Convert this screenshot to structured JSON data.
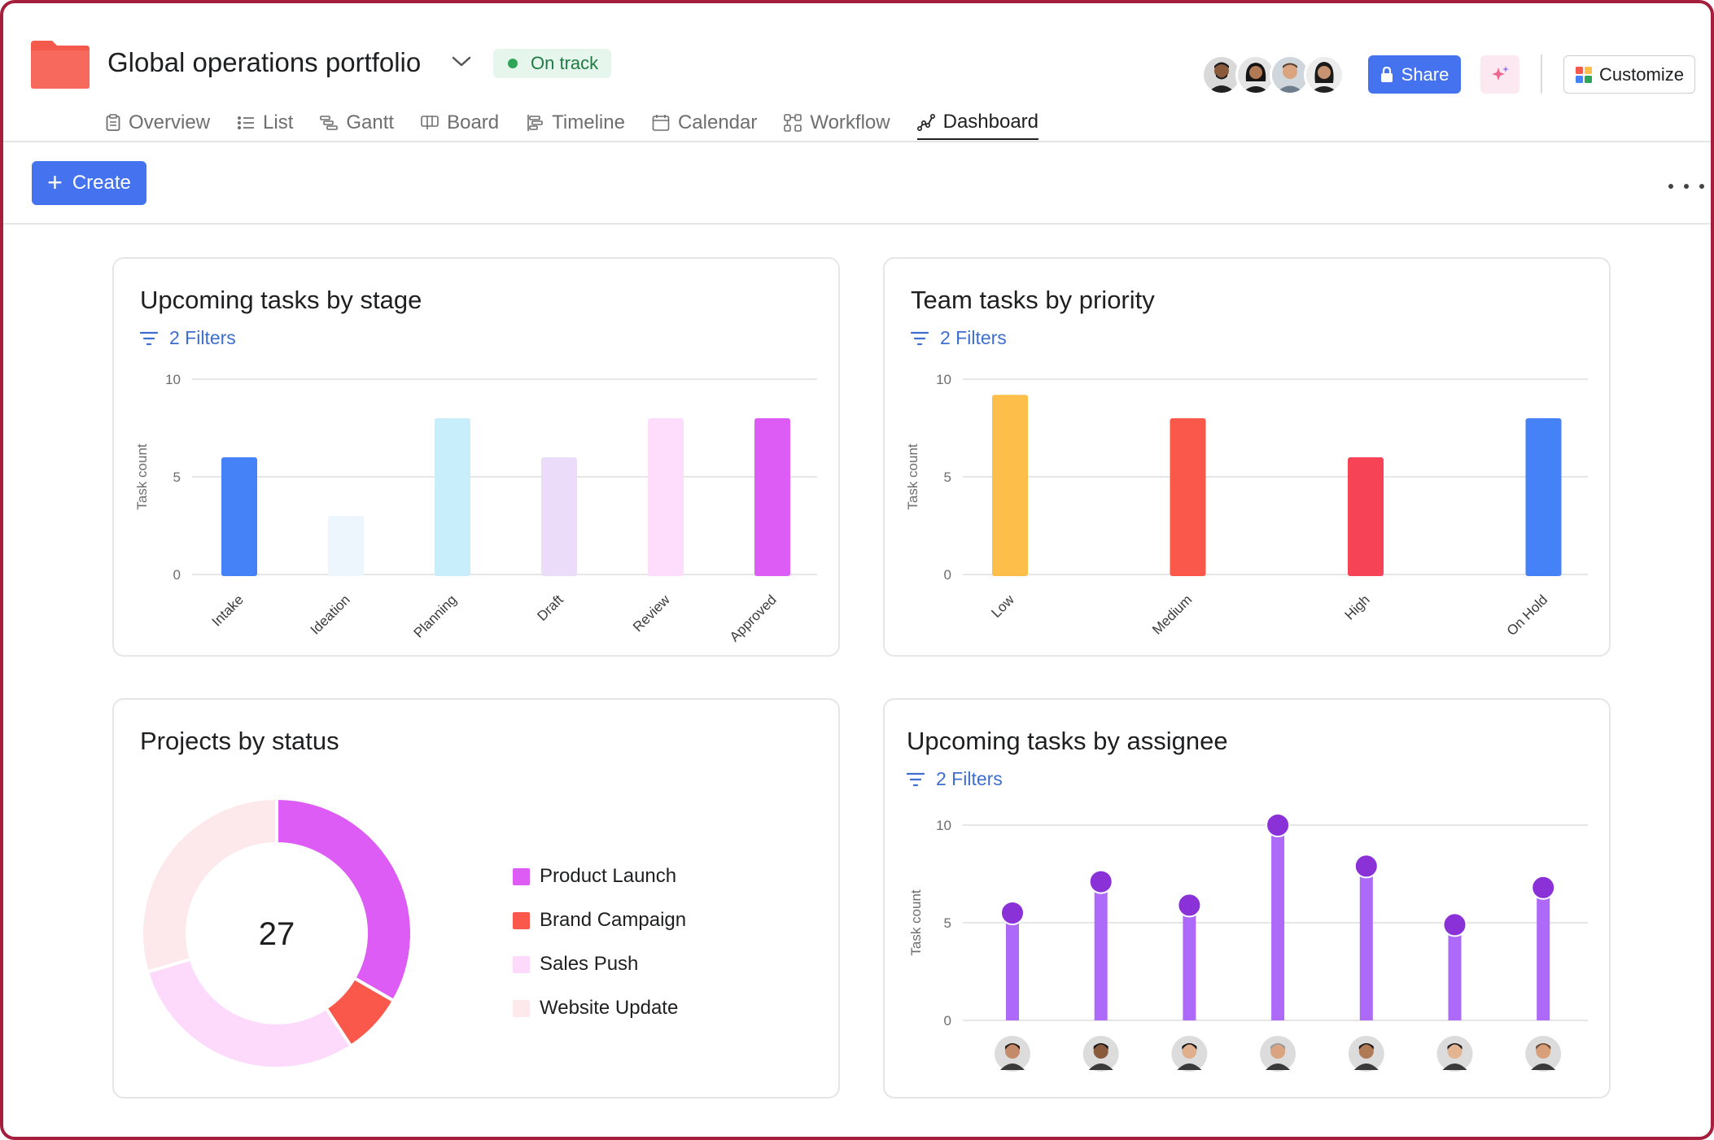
{
  "header": {
    "title": "Global operations portfolio",
    "status": {
      "label": "On track",
      "color": "#2fa55a"
    },
    "share_label": "Share",
    "customize_label": "Customize",
    "folder_color": "#f45a4c"
  },
  "tabs": [
    {
      "label": "Overview",
      "icon": "overview-icon",
      "active": false
    },
    {
      "label": "List",
      "icon": "list-icon",
      "active": false
    },
    {
      "label": "Gantt",
      "icon": "gantt-icon",
      "active": false
    },
    {
      "label": "Board",
      "icon": "board-icon",
      "active": false
    },
    {
      "label": "Timeline",
      "icon": "timeline-icon",
      "active": false
    },
    {
      "label": "Calendar",
      "icon": "calendar-icon",
      "active": false
    },
    {
      "label": "Workflow",
      "icon": "workflow-icon",
      "active": false
    },
    {
      "label": "Dashboard",
      "icon": "dashboard-icon",
      "active": true
    }
  ],
  "toolbar": {
    "create_label": "Create"
  },
  "cards": {
    "stage": {
      "title": "Upcoming tasks by stage",
      "filter_label": "2 Filters"
    },
    "priority": {
      "title": "Team tasks by priority",
      "filter_label": "2 Filters"
    },
    "projects": {
      "title": "Projects by status"
    },
    "assignee": {
      "title": "Upcoming tasks by assignee",
      "filter_label": "2 Filters"
    }
  },
  "chart_data": [
    {
      "type": "bar",
      "title": "Upcoming tasks by stage",
      "ylabel": "Task count",
      "ylim": [
        0,
        10
      ],
      "yticks": [
        0,
        5,
        10
      ],
      "grid": true,
      "categories": [
        "Intake",
        "Ideation",
        "Planning",
        "Draft",
        "Review",
        "Approved"
      ],
      "values": [
        6,
        3,
        8,
        6,
        8,
        8
      ],
      "colors": [
        "#4582f7",
        "#eef6fd",
        "#c8edfb",
        "#ebdcfa",
        "#fddcfc",
        "#dc5cf5"
      ]
    },
    {
      "type": "bar",
      "title": "Team tasks by priority",
      "ylabel": "Task count",
      "ylim": [
        0,
        10
      ],
      "yticks": [
        0,
        5,
        10
      ],
      "grid": true,
      "categories": [
        "Low",
        "Medium",
        "High",
        "On Hold"
      ],
      "values": [
        9.2,
        8,
        6,
        8
      ],
      "colors": [
        "#fdbe4a",
        "#fb584c",
        "#f64456",
        "#4582f7"
      ]
    },
    {
      "type": "pie",
      "title": "Projects by status",
      "total_label": "27",
      "categories": [
        "Product Launch",
        "Brand Campaign",
        "Sales Push",
        "Website Update"
      ],
      "values": [
        9,
        2,
        8,
        8
      ],
      "colors": [
        "#dc5cf5",
        "#fb584c",
        "#fdd9fc",
        "#fde8ec"
      ]
    },
    {
      "type": "bar",
      "title": "Upcoming tasks by assignee",
      "ylabel": "Task count",
      "ylim": [
        0,
        10
      ],
      "yticks": [
        0,
        5,
        10
      ],
      "grid": true,
      "categories": [
        "assignee-1",
        "assignee-2",
        "assignee-3",
        "assignee-4",
        "assignee-5",
        "assignee-6",
        "assignee-7"
      ],
      "values": [
        5.5,
        7.1,
        5.9,
        10,
        7.9,
        4.9,
        6.8
      ],
      "bar_color": "#ad6af8",
      "dot_color": "#8a31d8"
    }
  ]
}
